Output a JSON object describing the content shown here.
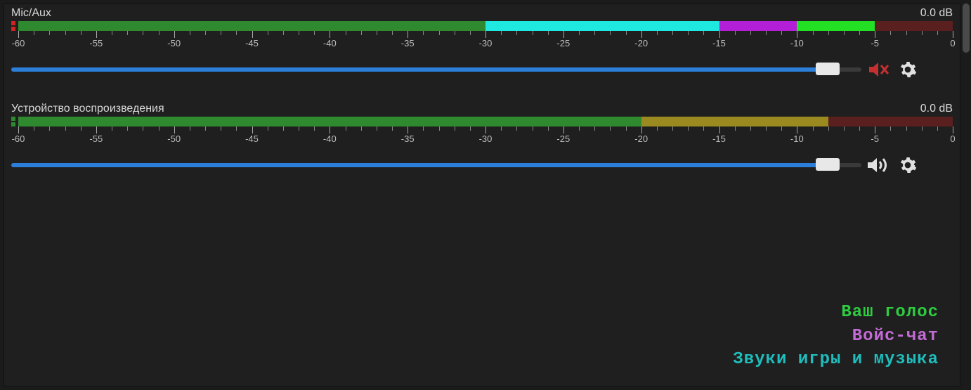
{
  "ticks": [
    -60,
    -55,
    -50,
    -45,
    -40,
    -35,
    -30,
    -25,
    -20,
    -15,
    -10,
    -5,
    0
  ],
  "mixer": [
    {
      "name": "Mic/Aux",
      "db": "0.0 dB",
      "muted": true,
      "peak_color": "#d02424",
      "slider_pct": 96,
      "segments": [
        {
          "color": "#2f8a2f",
          "from": -60,
          "to": -30
        },
        {
          "color": "#1fe8e0",
          "from": -30,
          "to": -15
        },
        {
          "color": "#b21fd6",
          "from": -15,
          "to": -10
        },
        {
          "color": "#24e024",
          "from": -10,
          "to": -5
        },
        {
          "color": "#5a1f1f",
          "from": -5,
          "to": 0
        }
      ]
    },
    {
      "name": "Устройство воспроизведения",
      "db": "0.0 dB",
      "muted": false,
      "peak_color": "#2f8a2f",
      "slider_pct": 96,
      "segments": [
        {
          "color": "#2f8a2f",
          "from": -60,
          "to": -20
        },
        {
          "color": "#9a8a1f",
          "from": -20,
          "to": -8
        },
        {
          "color": "#5a1f1f",
          "from": -8,
          "to": 0
        }
      ]
    }
  ],
  "legend": [
    {
      "label": "Ваш голос",
      "color": "#2ecc40"
    },
    {
      "label": "Войс-чат",
      "color": "#c36bd6"
    },
    {
      "label": "Звуки игры и музыка",
      "color": "#1fbdbd"
    }
  ]
}
